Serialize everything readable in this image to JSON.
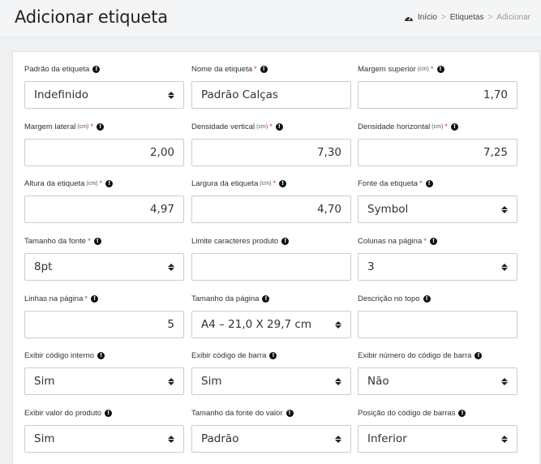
{
  "header": {
    "title": "Adicionar etiqueta",
    "breadcrumb": {
      "home": "Início",
      "section": "Etiquetas",
      "current": "Adicionar",
      "separator": ">"
    }
  },
  "fields": [
    {
      "label": "Padrão da etiqueta",
      "unit": "",
      "required": false,
      "type": "select",
      "value": "Indefinido"
    },
    {
      "label": "Nome da etiqueta",
      "unit": "",
      "required": true,
      "type": "text",
      "value": "Padrão Calças"
    },
    {
      "label": "Margem superior",
      "unit": "(cm)",
      "required": true,
      "type": "number",
      "value": "1,70"
    },
    {
      "label": "Margem lateral",
      "unit": "(cm)",
      "required": true,
      "type": "number",
      "value": "2,00"
    },
    {
      "label": "Densidade vertical",
      "unit": "(cm)",
      "required": true,
      "type": "number",
      "value": "7,30"
    },
    {
      "label": "Densidade horizontal",
      "unit": "(cm)",
      "required": true,
      "type": "number",
      "value": "7,25"
    },
    {
      "label": "Altura da etiqueta",
      "unit": "(cm)",
      "required": true,
      "type": "number",
      "value": "4,97"
    },
    {
      "label": "Largura da etiqueta",
      "unit": "(cm)",
      "required": true,
      "type": "number",
      "value": "4,70"
    },
    {
      "label": "Fonte da etiqueta",
      "unit": "",
      "required": true,
      "type": "select",
      "value": "Symbol"
    },
    {
      "label": "Tamanho da fonte",
      "unit": "",
      "required": true,
      "type": "select",
      "value": "8pt"
    },
    {
      "label": "Limite caracteres produto",
      "unit": "",
      "required": false,
      "type": "text",
      "value": ""
    },
    {
      "label": "Colunas na página",
      "unit": "",
      "required": true,
      "type": "select",
      "value": "3"
    },
    {
      "label": "Linhas na página",
      "unit": "",
      "required": true,
      "type": "number",
      "value": "5"
    },
    {
      "label": "Tamanho da página",
      "unit": "",
      "required": false,
      "type": "select",
      "value": "A4 – 21,0 X 29,7 cm"
    },
    {
      "label": "Descrição no topo",
      "unit": "",
      "required": false,
      "type": "text",
      "value": ""
    },
    {
      "label": "Exibir código interno",
      "unit": "",
      "required": false,
      "type": "select",
      "value": "Sim"
    },
    {
      "label": "Exibir código de barra",
      "unit": "",
      "required": false,
      "type": "select",
      "value": "Sim"
    },
    {
      "label": "Exibir número do código de barra",
      "unit": "",
      "required": false,
      "type": "select",
      "value": "Não"
    },
    {
      "label": "Exibir valor do produto",
      "unit": "",
      "required": false,
      "type": "select",
      "value": "Sim"
    },
    {
      "label": "Tamanho da fonte do valor",
      "unit": "",
      "required": false,
      "type": "select",
      "value": "Padrão"
    },
    {
      "label": "Posição do código de barras",
      "unit": "",
      "required": false,
      "type": "select",
      "value": "Inferior"
    }
  ],
  "colors": {
    "required": "#e23b3b",
    "border": "#cccccc",
    "background": "#eef0f2"
  }
}
